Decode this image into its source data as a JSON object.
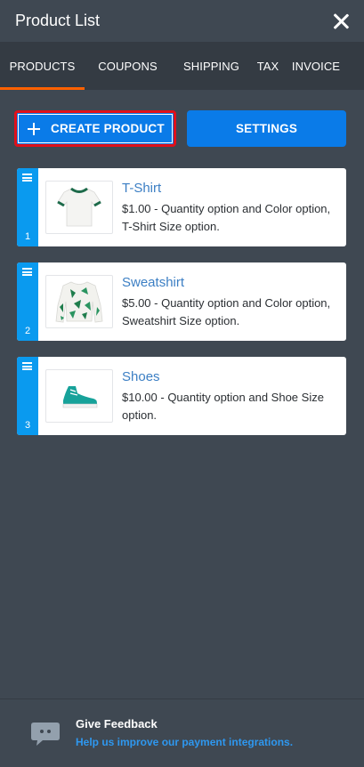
{
  "header": {
    "title": "Product List"
  },
  "tabs": [
    {
      "label": "PRODUCTS"
    },
    {
      "label": "COUPONS"
    },
    {
      "label": "SHIPPING"
    },
    {
      "label": "TAX"
    },
    {
      "label": "INVOICE"
    }
  ],
  "actions": {
    "create_label": "CREATE PRODUCT",
    "settings_label": "SETTINGS"
  },
  "products": [
    {
      "index": "1",
      "name": "T-Shirt",
      "description": "$1.00 - Quantity option and Color option, T-Shirt Size option."
    },
    {
      "index": "2",
      "name": "Sweatshirt",
      "description": "$5.00 - Quantity option and Color option, Sweatshirt Size option."
    },
    {
      "index": "3",
      "name": "Shoes",
      "description": "$10.00 - Quantity option and Shoe Size option."
    }
  ],
  "footer": {
    "title": "Give Feedback",
    "link": "Help us improve our payment integrations."
  },
  "colors": {
    "accent": "#0a7be8",
    "active_tab_underline": "#ff6100",
    "highlight_border": "#e0101a",
    "background": "#3f4852"
  }
}
